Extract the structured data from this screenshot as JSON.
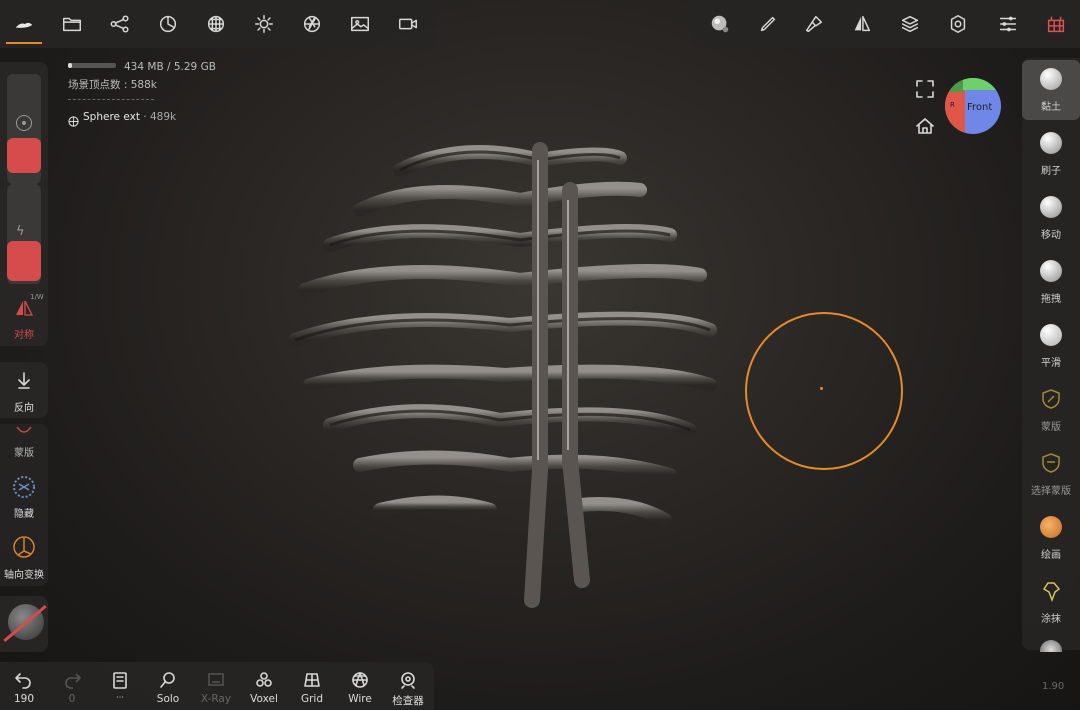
{
  "top_left_toolbar": {
    "icons": [
      "scene-menu-icon",
      "folder-icon",
      "share-nodes-icon",
      "material-icon",
      "texture-sphere-icon",
      "light-icon",
      "render-aperture-icon",
      "image-icon",
      "video-camera-icon"
    ]
  },
  "top_right_toolbar": {
    "icons": [
      "material-preview-icon",
      "brush-stroke-icon",
      "paint-tool-icon",
      "symmetry-icon",
      "layers-icon",
      "settings-gear-icon",
      "sliders-icon",
      "topology-grid-icon"
    ]
  },
  "info": {
    "memory": "434 MB / 5.29 GB",
    "scene_vertices": "场景顶点数 : 588k",
    "object_name": "Sphere ext",
    "object_vertices": "· 489k"
  },
  "left_sidebar": {
    "symmetry_small": "1/W",
    "symmetry_label": "对称",
    "invert_label": "反向",
    "mask_label": "蒙版",
    "hide_label": "隐藏",
    "gizmo_label": "轴向变换"
  },
  "right_sidebar": {
    "tools": [
      {
        "label": "黏土",
        "color": "#d9d9d9"
      },
      {
        "label": "刷子",
        "color": "#d9d9d9"
      },
      {
        "label": "移动",
        "color": "#d9d9d9"
      },
      {
        "label": "拖拽",
        "color": "#d9d9d9"
      },
      {
        "label": "平滑",
        "color": "#d9d9d9"
      },
      {
        "label": "蒙版",
        "color": "#a18a3a"
      },
      {
        "label": "选择蒙版",
        "color": "#a18a3a"
      },
      {
        "label": "绘画",
        "color": "#e39a4a"
      },
      {
        "label": "涂抹",
        "color": "#d6c15a"
      }
    ]
  },
  "view_cube": {
    "face_label": "Front",
    "left_label": "R"
  },
  "bottom_toolbar": {
    "undo_count": "190",
    "redo_count": "0",
    "items": [
      "Solo",
      "X-Ray",
      "Voxel",
      "Grid",
      "Wire",
      "检查器"
    ],
    "version": "1.90"
  }
}
